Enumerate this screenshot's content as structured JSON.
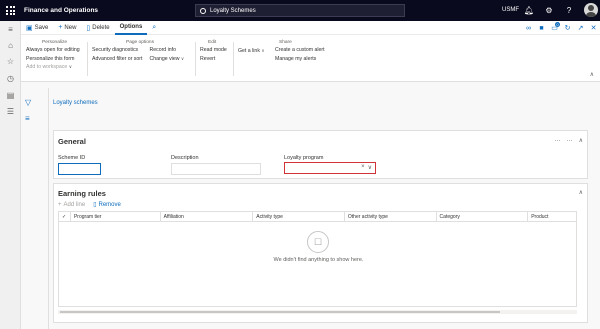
{
  "topbar": {
    "app_title": "Finance and Operations",
    "search_text": "Loyalty Schemes",
    "company": "USMF",
    "icons": [
      "waffle-icon",
      "search-icon",
      "bell-icon",
      "gear-icon",
      "help-icon",
      "avatar"
    ]
  },
  "actionbar": {
    "save": "Save",
    "new": "New",
    "delete": "Delete",
    "options": "Options",
    "notification_count": "0"
  },
  "ribbon": {
    "personalize": {
      "title": "Personalize",
      "items": [
        "Always open for editing",
        "Personalize this form",
        "Add to workspace"
      ]
    },
    "page_options": {
      "title": "Page options",
      "col1": [
        "Security diagnostics",
        "Advanced filter or sort"
      ],
      "col2": [
        "Record info",
        "Change view"
      ]
    },
    "edit": {
      "title": "Edit",
      "items": [
        "Read mode",
        "Revert"
      ]
    },
    "get_a_link": "Get a link",
    "share": {
      "title": "Share",
      "items": [
        "Create a custom alert",
        "Manage my alerts"
      ]
    }
  },
  "content": {
    "breadcrumb": "Loyalty schemes",
    "general": {
      "title": "General",
      "scheme_id_label": "Scheme ID",
      "scheme_id_value": "",
      "description_label": "Description",
      "description_value": "",
      "loyalty_program_label": "Loyalty program",
      "loyalty_program_value": ""
    },
    "earning_rules": {
      "title": "Earning rules",
      "add_line": "Add line",
      "remove": "Remove",
      "columns": [
        "Program tier",
        "Affiliation",
        "Activity type",
        "Other activity type",
        "Category",
        "Product"
      ],
      "empty_message": "We didn't find anything to show here."
    }
  }
}
